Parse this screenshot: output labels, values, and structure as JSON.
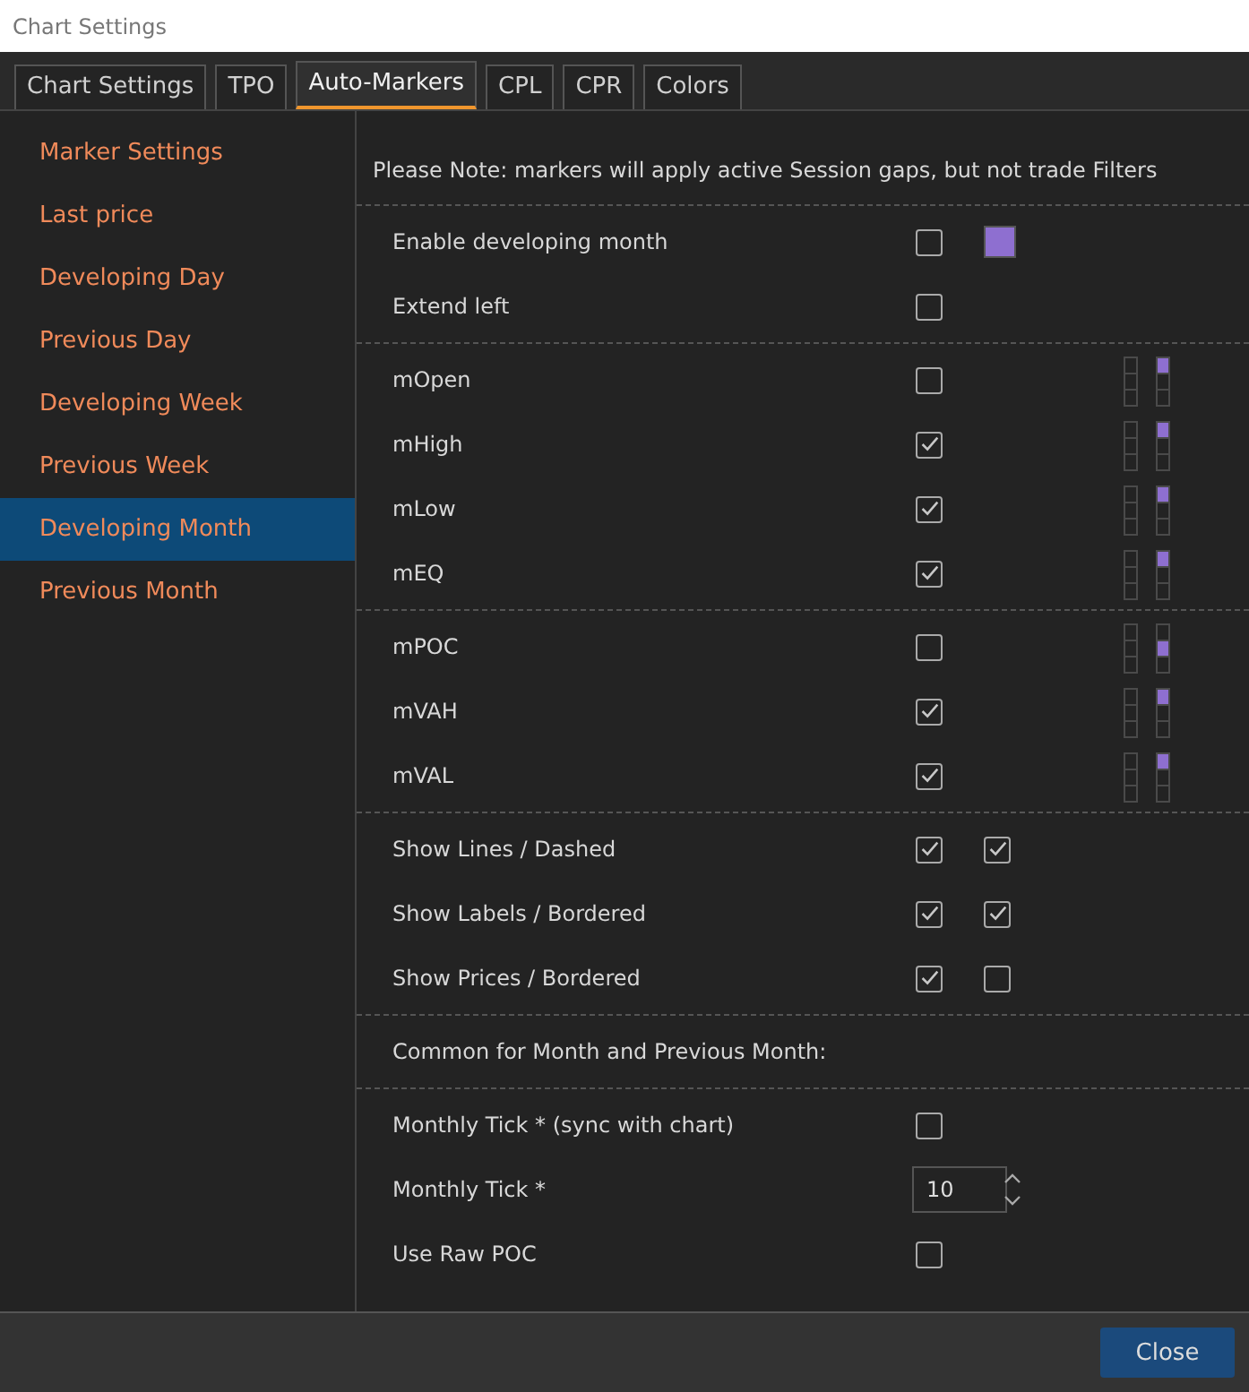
{
  "window": {
    "title": "Chart Settings"
  },
  "tabs": [
    {
      "label": "Chart Settings",
      "selected": false
    },
    {
      "label": "TPO",
      "selected": false
    },
    {
      "label": "Auto-Markers",
      "selected": true
    },
    {
      "label": "CPL",
      "selected": false
    },
    {
      "label": "CPR",
      "selected": false
    },
    {
      "label": "Colors",
      "selected": false
    }
  ],
  "sidebar": {
    "items": [
      {
        "label": "Marker Settings",
        "selected": false
      },
      {
        "label": "Last price",
        "selected": false
      },
      {
        "label": "Developing Day",
        "selected": false
      },
      {
        "label": "Previous Day",
        "selected": false
      },
      {
        "label": "Developing Week",
        "selected": false
      },
      {
        "label": "Previous Week",
        "selected": false
      },
      {
        "label": "Developing Month",
        "selected": true
      },
      {
        "label": "Previous Month",
        "selected": false
      }
    ]
  },
  "note": "Please Note: markers will apply active Session gaps, but not trade Filters",
  "sections": [
    {
      "rows": [
        {
          "kind": "color",
          "label": "Enable developing month",
          "checked": false,
          "color": "#8e6fd0"
        },
        {
          "kind": "check",
          "label": "Extend left",
          "checked": false
        }
      ]
    },
    {
      "rows": [
        {
          "kind": "grid",
          "label": "mOpen",
          "checked": false,
          "cells": [
            {
              "selected": false
            },
            {
              "selected": false
            },
            {
              "selected": false
            },
            {
              "selected": true
            },
            {
              "selected": false
            },
            {
              "selected": false
            }
          ]
        },
        {
          "kind": "grid",
          "label": "mHigh",
          "checked": true,
          "cells": [
            {
              "selected": false
            },
            {
              "selected": false
            },
            {
              "selected": false
            },
            {
              "selected": true
            },
            {
              "selected": false
            },
            {
              "selected": false
            }
          ]
        },
        {
          "kind": "grid",
          "label": "mLow",
          "checked": true,
          "cells": [
            {
              "selected": false
            },
            {
              "selected": false
            },
            {
              "selected": false
            },
            {
              "selected": true
            },
            {
              "selected": false
            },
            {
              "selected": false
            }
          ]
        },
        {
          "kind": "grid",
          "label": "mEQ",
          "checked": true,
          "cells": [
            {
              "selected": false
            },
            {
              "selected": false
            },
            {
              "selected": false
            },
            {
              "selected": true
            },
            {
              "selected": false
            },
            {
              "selected": false
            }
          ]
        }
      ]
    },
    {
      "rows": [
        {
          "kind": "grid",
          "label": "mPOC",
          "checked": false,
          "cells": [
            {
              "selected": false
            },
            {
              "selected": false
            },
            {
              "selected": false
            },
            {
              "selected": false
            },
            {
              "selected": true
            },
            {
              "selected": false
            }
          ]
        },
        {
          "kind": "grid",
          "label": "mVAH",
          "checked": true,
          "cells": [
            {
              "selected": false
            },
            {
              "selected": false
            },
            {
              "selected": false
            },
            {
              "selected": true
            },
            {
              "selected": false
            },
            {
              "selected": false
            }
          ]
        },
        {
          "kind": "grid",
          "label": "mVAL",
          "checked": true,
          "cells": [
            {
              "selected": false
            },
            {
              "selected": false
            },
            {
              "selected": false
            },
            {
              "selected": true
            },
            {
              "selected": false
            },
            {
              "selected": false
            }
          ]
        }
      ]
    },
    {
      "rows": [
        {
          "kind": "pair",
          "label": "Show Lines / Dashed",
          "checked": true,
          "checked2": true
        },
        {
          "kind": "pair",
          "label": "Show Labels / Bordered",
          "checked": true,
          "checked2": true
        },
        {
          "kind": "pair",
          "label": "Show Prices / Bordered",
          "checked": true,
          "checked2": false
        }
      ]
    },
    {
      "rows": [
        {
          "kind": "heading",
          "label": "Common for Month and Previous Month:"
        }
      ]
    },
    {
      "rows": [
        {
          "kind": "check",
          "label": "Monthly Tick * (sync with chart)",
          "checked": false
        },
        {
          "kind": "number",
          "label": "Monthly Tick *",
          "value": "10"
        },
        {
          "kind": "check",
          "label": "Use Raw POC",
          "checked": false
        }
      ]
    }
  ],
  "buttons": [
    {
      "label": "Close"
    }
  ]
}
